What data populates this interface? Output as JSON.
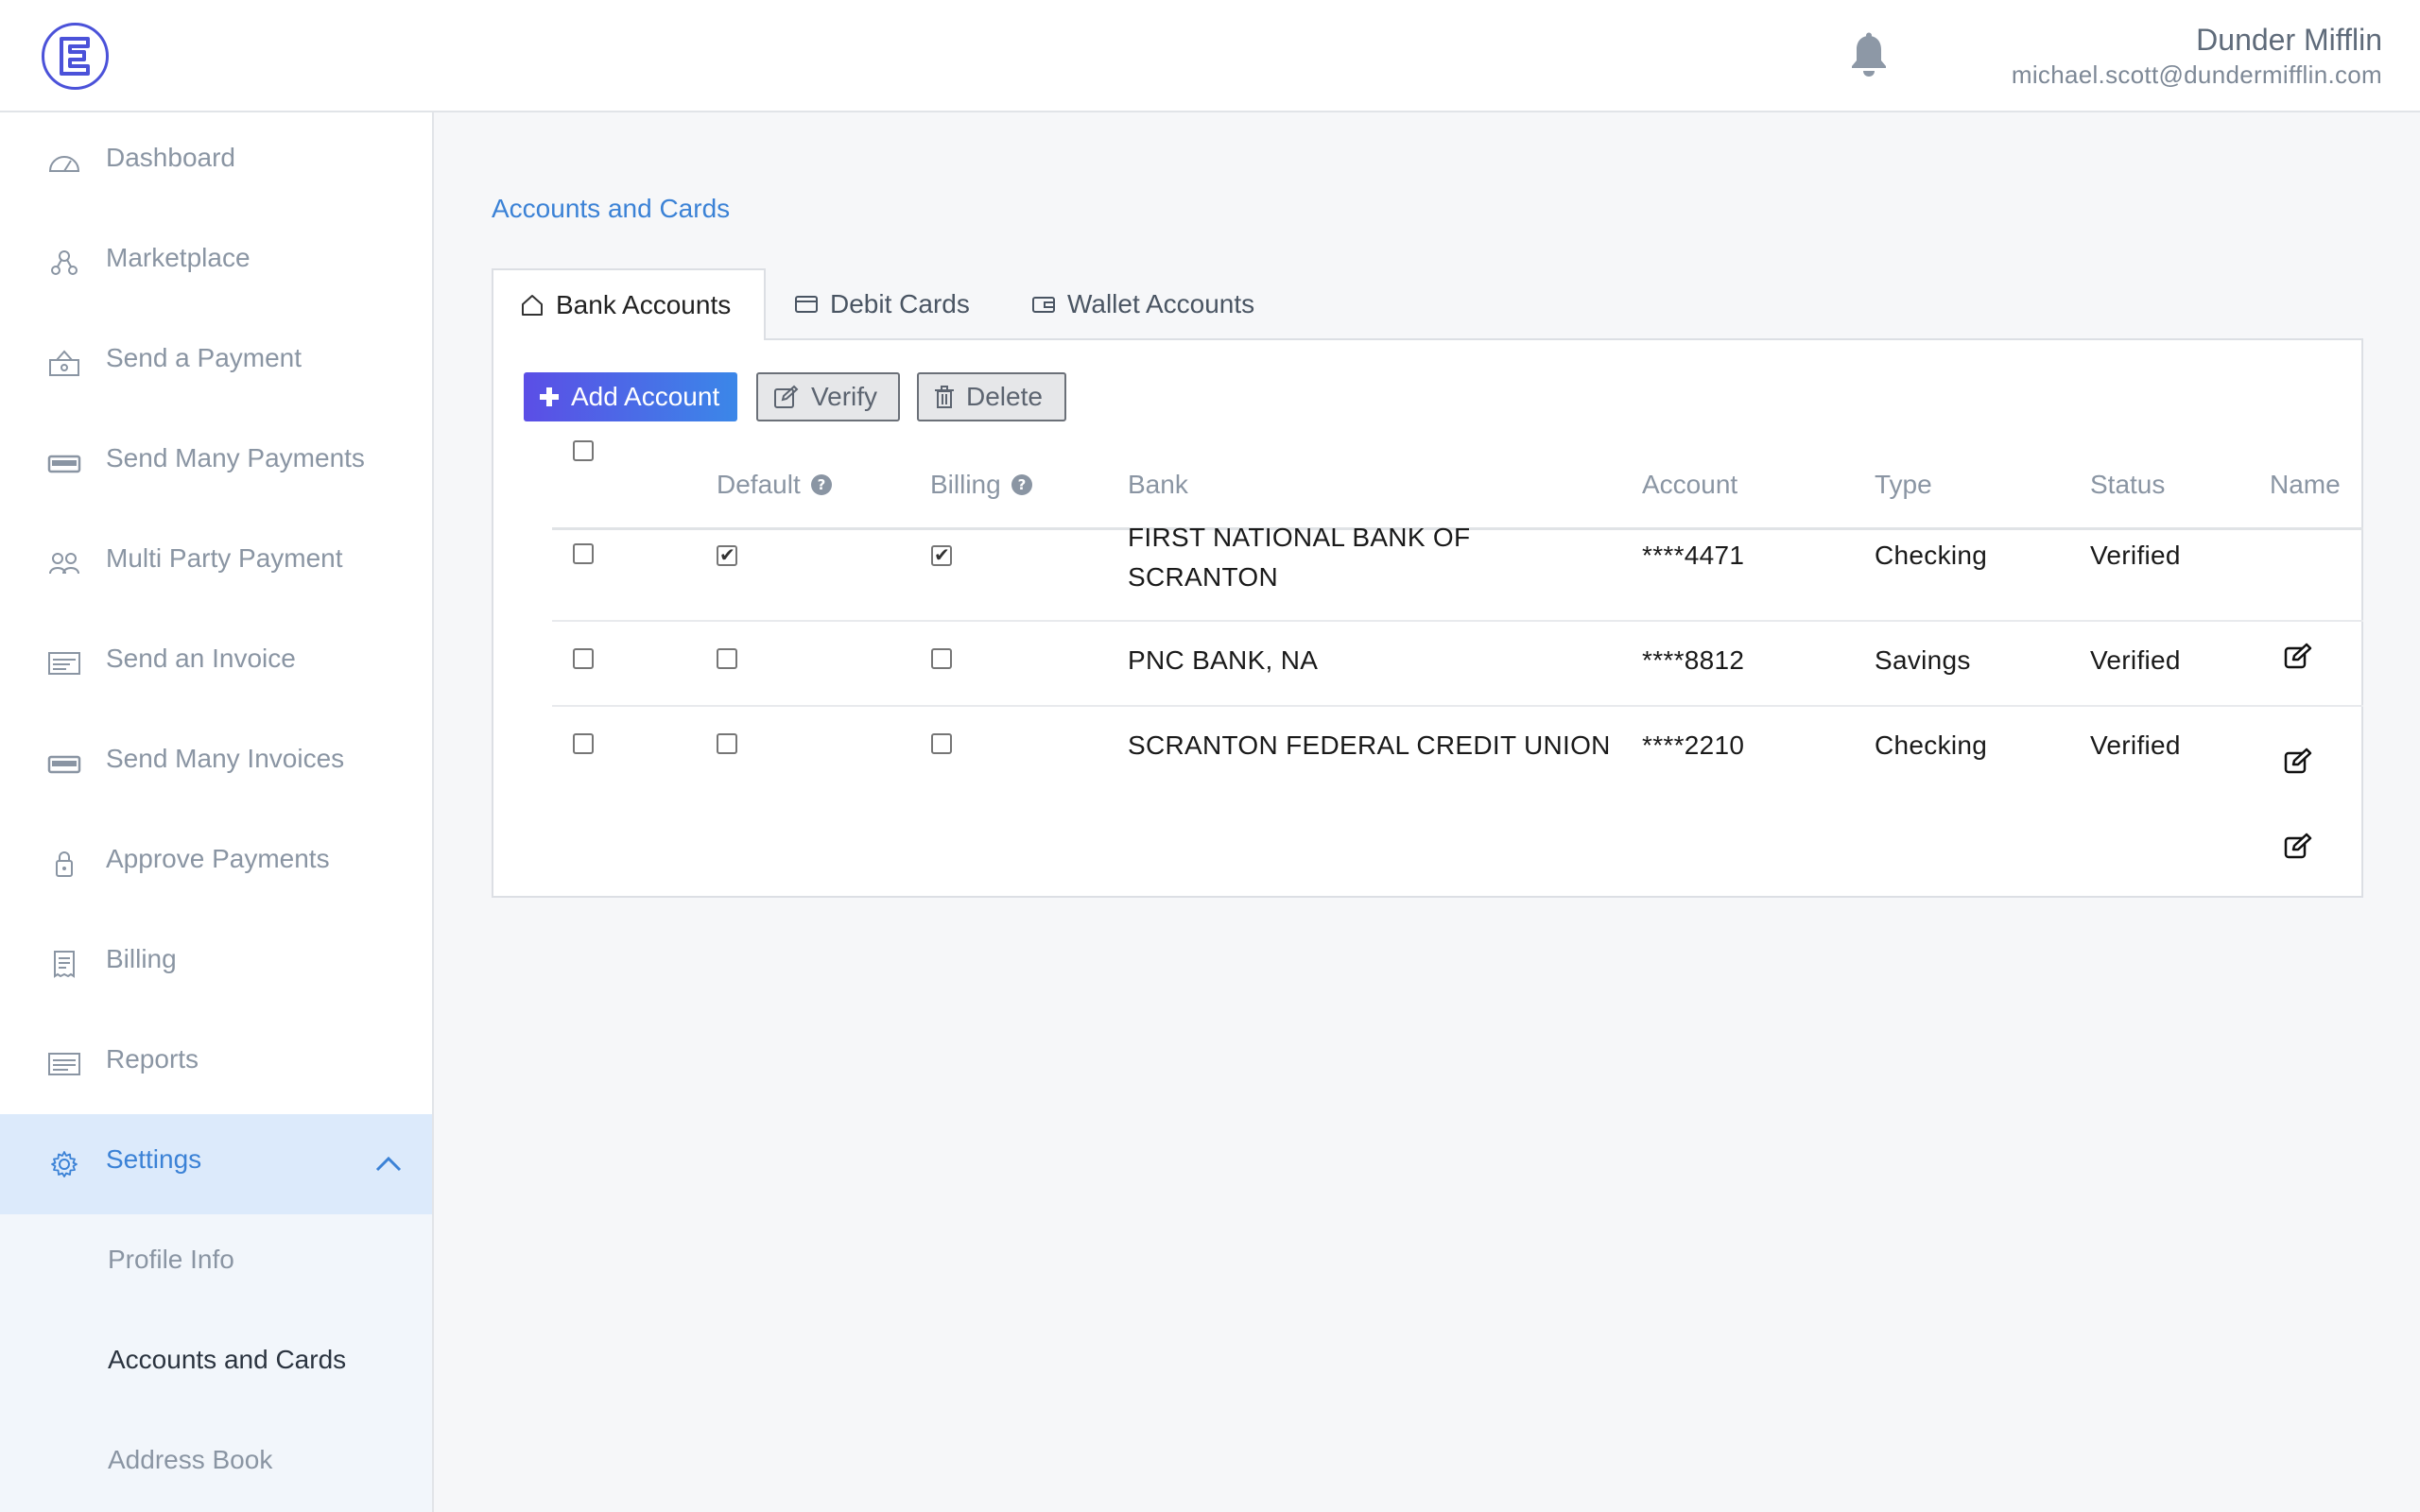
{
  "header": {
    "org_name": "Dunder Mifflin",
    "user_email": "michael.scott@dundermifflin.com",
    "logo_letter": "E"
  },
  "sidebar": {
    "items": [
      {
        "label": "Dashboard",
        "icon": "dashboard-gauge-icon"
      },
      {
        "label": "Marketplace",
        "icon": "marketplace-nodes-icon"
      },
      {
        "label": "Send a Payment",
        "icon": "send-payment-icon"
      },
      {
        "label": "Send Many Payments",
        "icon": "send-many-payments-icon"
      },
      {
        "label": "Multi Party Payment",
        "icon": "multi-party-icon"
      },
      {
        "label": "Send an Invoice",
        "icon": "invoice-icon"
      },
      {
        "label": "Send Many Invoices",
        "icon": "many-invoices-icon"
      },
      {
        "label": "Approve Payments",
        "icon": "lock-icon"
      },
      {
        "label": "Billing",
        "icon": "receipt-icon"
      },
      {
        "label": "Reports",
        "icon": "reports-icon"
      },
      {
        "label": "Settings",
        "icon": "gear-icon"
      }
    ],
    "submenu": [
      {
        "label": "Profile Info"
      },
      {
        "label": "Accounts and Cards"
      },
      {
        "label": "Address Book"
      }
    ]
  },
  "main": {
    "title": "Accounts and Cards",
    "tabs": [
      {
        "label": "Bank Accounts",
        "icon": "home-icon"
      },
      {
        "label": "Debit Cards",
        "icon": "card-icon"
      },
      {
        "label": "Wallet Accounts",
        "icon": "wallet-icon"
      }
    ],
    "buttons": {
      "add": "Add Account",
      "verify": "Verify",
      "delete": "Delete"
    },
    "table": {
      "columns": [
        "Default",
        "Billing",
        "Bank",
        "Account",
        "Type",
        "Status",
        "Name"
      ],
      "rows": [
        {
          "bank": "FIRST NATIONAL BANK OF SCRANTON",
          "account": "****4471",
          "type": "Checking",
          "status": "Verified",
          "default": true,
          "billing": true
        },
        {
          "bank": "PNC BANK, NA",
          "account": "****8812",
          "type": "Savings",
          "status": "Verified",
          "default": false,
          "billing": false
        },
        {
          "bank": "SCRANTON FEDERAL CREDIT UNION",
          "account": "****2210",
          "type": "Checking",
          "status": "Verified",
          "default": false,
          "billing": false
        }
      ]
    }
  },
  "colors": {
    "accent": "#3b82d6",
    "active_nav_bg": "#dceafb",
    "button_gradient_start": "#5b4ee6",
    "button_gradient_end": "#3b87e8"
  }
}
